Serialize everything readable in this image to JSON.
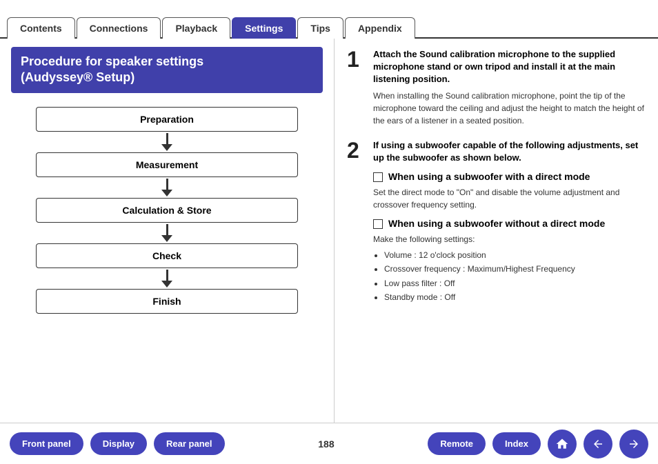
{
  "tabs": [
    {
      "id": "contents",
      "label": "Contents",
      "active": false
    },
    {
      "id": "connections",
      "label": "Connections",
      "active": false
    },
    {
      "id": "playback",
      "label": "Playback",
      "active": false
    },
    {
      "id": "settings",
      "label": "Settings",
      "active": true
    },
    {
      "id": "tips",
      "label": "Tips",
      "active": false
    },
    {
      "id": "appendix",
      "label": "Appendix",
      "active": false
    }
  ],
  "left_panel": {
    "title_line1": "Procedure for speaker settings",
    "title_line2": "(Audyssey® Setup)",
    "flowchart": [
      "Preparation",
      "Measurement",
      "Calculation & Store",
      "Check",
      "Finish"
    ]
  },
  "right_panel": {
    "step1": {
      "number": "1",
      "title": "Attach the Sound calibration microphone to the supplied microphone stand or own tripod and install it at the main listening position.",
      "desc": "When installing the Sound calibration microphone, point the tip of the microphone toward the ceiling and adjust the height to match the height of the ears of a listener in a seated position."
    },
    "step2": {
      "number": "2",
      "title": "If using a subwoofer capable of the following adjustments, set up the subwoofer as shown below.",
      "sub1": {
        "label": "When using a subwoofer with a direct mode",
        "desc": "Set the direct mode to \"On\" and disable the volume adjustment and crossover frequency setting."
      },
      "sub2": {
        "label": "When using a subwoofer without a direct mode",
        "intro": "Make the following settings:",
        "bullets": [
          "Volume : 12 o'clock position",
          "Crossover frequency : Maximum/Highest Frequency",
          "Low pass filter : Off",
          "Standby mode : Off"
        ]
      }
    }
  },
  "bottom_bar": {
    "page_number": "188",
    "btn_front_panel": "Front panel",
    "btn_display": "Display",
    "btn_rear_panel": "Rear panel",
    "btn_remote": "Remote",
    "btn_index": "Index"
  }
}
